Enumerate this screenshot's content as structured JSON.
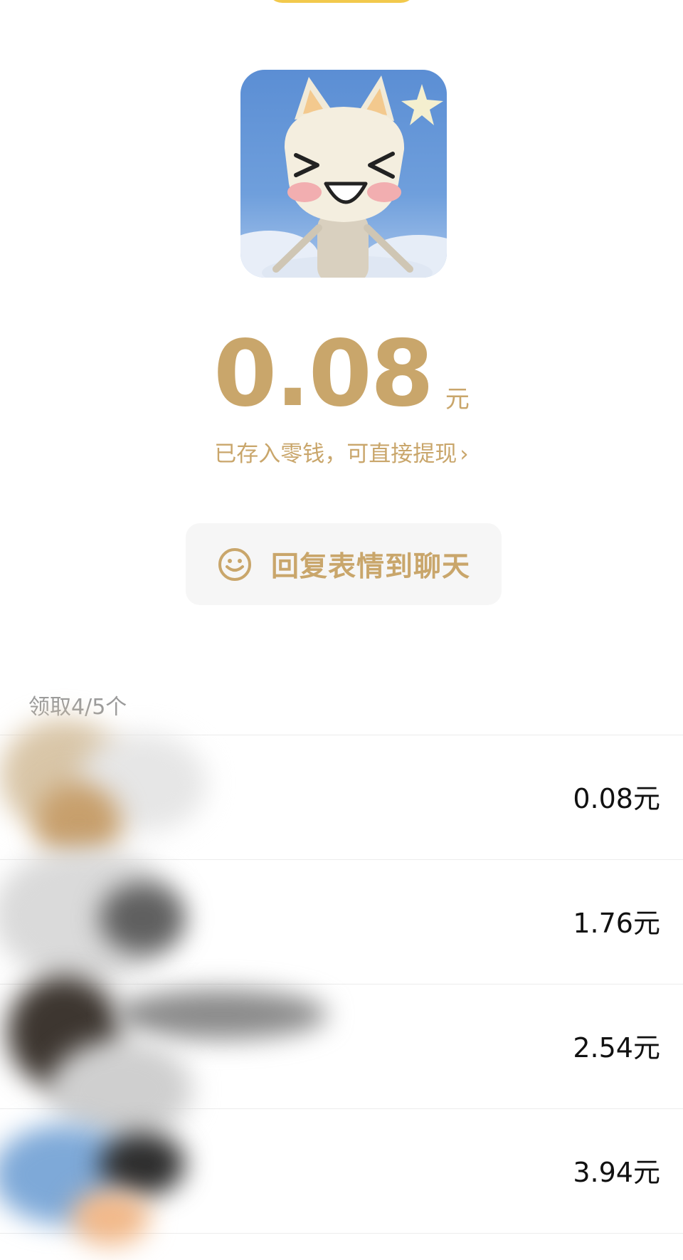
{
  "header": {
    "partial_title": ""
  },
  "amount": {
    "value": "0.08",
    "unit": "元",
    "hint": "已存入零钱，可直接提现",
    "hint_chevron": "›"
  },
  "reply_button": {
    "label": "回复表情到聊天",
    "icon": "smile-icon"
  },
  "received": {
    "count_label": "领取4/5个",
    "items": [
      {
        "amount": "0.08元"
      },
      {
        "amount": "1.76元"
      },
      {
        "amount": "2.54元"
      },
      {
        "amount": "3.94元"
      }
    ]
  },
  "colors": {
    "accent_gold": "#c9a66b",
    "button_bg": "#f6f6f6",
    "divider": "#ececec",
    "muted_text": "#9a9a9a"
  }
}
